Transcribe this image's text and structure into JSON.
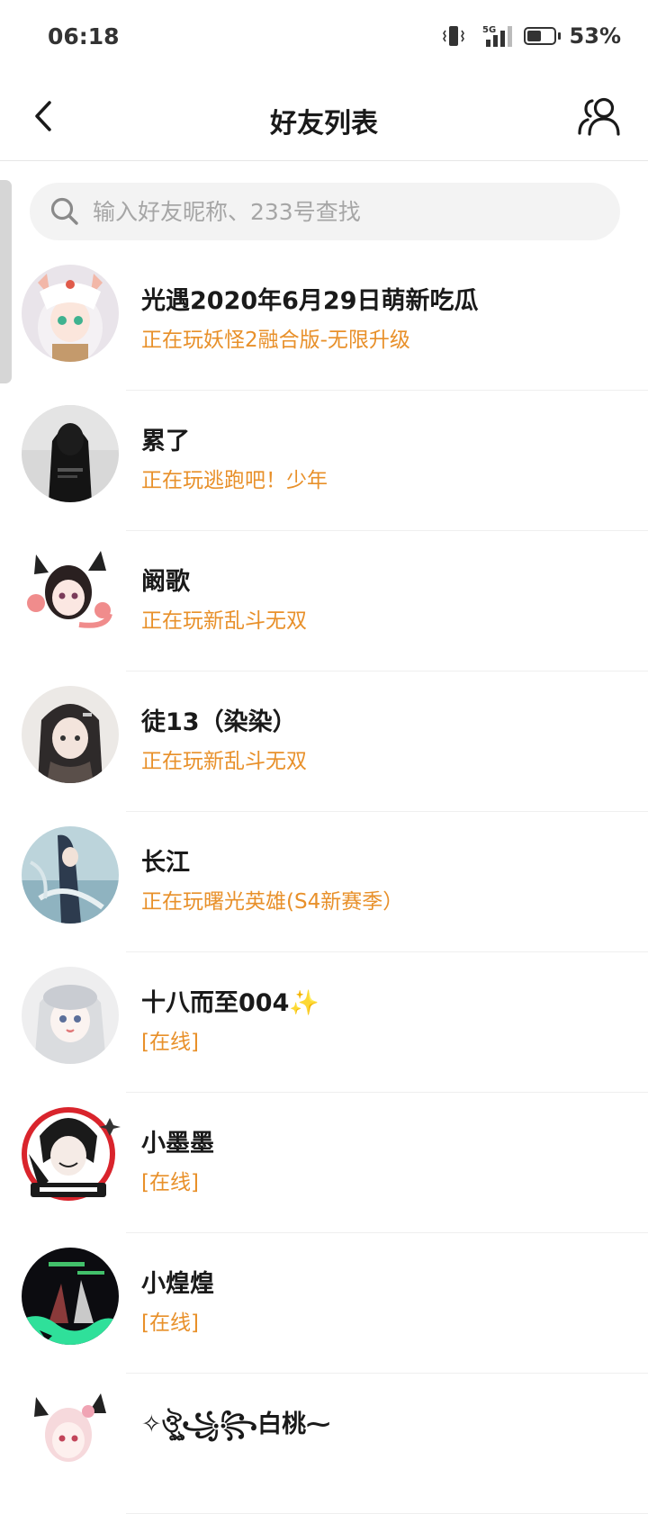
{
  "status_bar": {
    "time": "06:18",
    "network": "5G",
    "battery_percent": 53,
    "battery_text": "53%"
  },
  "header": {
    "title": "好友列表",
    "back_icon": "chevron-left-icon",
    "friends_icon": "users-icon"
  },
  "search": {
    "placeholder": "输入好友昵称、233号查找",
    "value": ""
  },
  "colors": {
    "status_orange": "#e8902a",
    "search_bg": "#f3f3f3"
  },
  "friends": [
    {
      "name": "光遇2020年6月29日萌新吃瓜",
      "status": "正在玩妖怪2融合版-无限升级"
    },
    {
      "name": "累了",
      "status": "正在玩逃跑吧！少年"
    },
    {
      "name": "阚歌",
      "status": "正在玩新乱斗无双"
    },
    {
      "name": "徒13（染染）",
      "status": "正在玩新乱斗无双"
    },
    {
      "name": "长江",
      "status": "正在玩曙光英雄(S4新赛季）"
    },
    {
      "name": "十八而至004✨",
      "status": "[在线]"
    },
    {
      "name": "小墨墨",
      "status": "[在线]"
    },
    {
      "name": "小煌煌",
      "status": "[在线]"
    },
    {
      "name": "✧ঔৣ꧁꧂白桃⁓",
      "status": ""
    }
  ]
}
